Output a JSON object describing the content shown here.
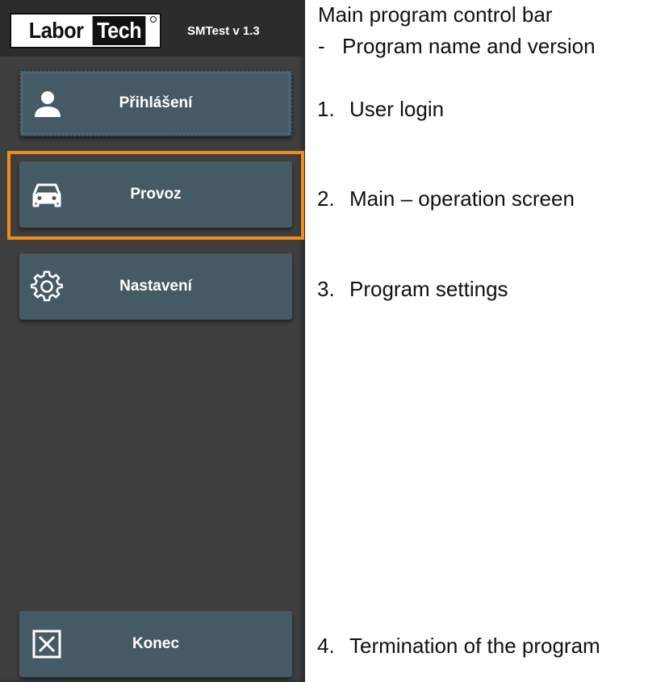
{
  "header": {
    "logo_labor": "Labor",
    "logo_tech": "Tech",
    "version": "SMTest v 1.3"
  },
  "sidebar": {
    "items": [
      {
        "label": "Přihlášení",
        "icon": "user-icon"
      },
      {
        "label": "Provoz",
        "icon": "car-icon"
      },
      {
        "label": "Nastavení",
        "icon": "gear-icon"
      },
      {
        "label": "Konec",
        "icon": "close-box-icon"
      }
    ],
    "highlight_color": "#f28c1b",
    "button_color": "#465a66",
    "background_color": "#3f3f3f"
  },
  "annotations": {
    "title": "Main program control bar",
    "subtitle_dash": "-",
    "subtitle": "Program name and version",
    "items": [
      {
        "number": "1.",
        "text": "User login"
      },
      {
        "number": "2.",
        "text": "Main – operation screen"
      },
      {
        "number": "3.",
        "text": "Program settings"
      },
      {
        "number": "4.",
        "text": "Termination of the program"
      }
    ]
  }
}
